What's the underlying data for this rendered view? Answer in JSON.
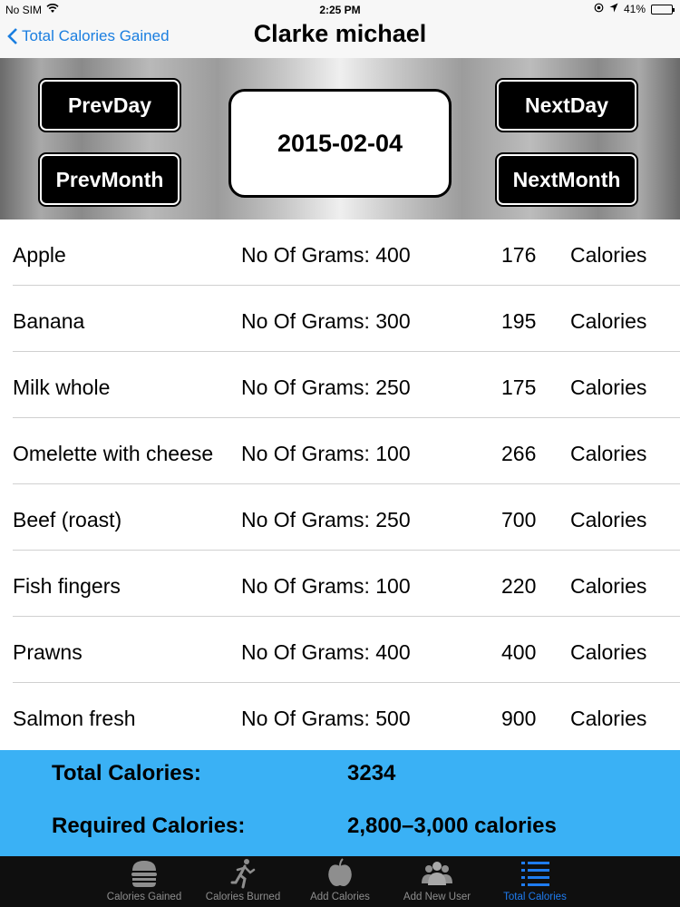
{
  "status_bar": {
    "carrier": "No SIM",
    "time": "2:25 PM",
    "battery": "41%",
    "battery_level": 0.41
  },
  "nav": {
    "back_label": "Total Calories Gained",
    "title": "Clarke michael"
  },
  "controls": {
    "prev_day": "PrevDay",
    "prev_month": "PrevMonth",
    "next_day": "NextDay",
    "next_month": "NextMonth",
    "date": "2015-02-04"
  },
  "foods": [
    {
      "name": "Apple",
      "grams": "No Of Grams: 400",
      "calories": "176",
      "unit": "Calories"
    },
    {
      "name": "Banana",
      "grams": "No Of Grams: 300",
      "calories": "195",
      "unit": "Calories"
    },
    {
      "name": "Milk whole",
      "grams": "No Of Grams: 250",
      "calories": "175",
      "unit": "Calories"
    },
    {
      "name": "Omelette with cheese",
      "grams": "No Of Grams: 100",
      "calories": "266",
      "unit": "Calories"
    },
    {
      "name": "Beef (roast)",
      "grams": "No Of Grams: 250",
      "calories": "700",
      "unit": "Calories"
    },
    {
      "name": "Fish fingers",
      "grams": "No Of Grams: 100",
      "calories": "220",
      "unit": "Calories"
    },
    {
      "name": "Prawns",
      "grams": "No Of Grams: 400",
      "calories": "400",
      "unit": "Calories"
    },
    {
      "name": "Salmon fresh",
      "grams": "No Of Grams: 500",
      "calories": "900",
      "unit": "Calories"
    }
  ],
  "totals": {
    "total_label": "Total Calories:",
    "total_value": "3234",
    "required_label": "Required  Calories:",
    "required_value": "2,800–3,000 calories"
  },
  "tabs": [
    {
      "label": "Calories Gained",
      "icon": "burger-icon"
    },
    {
      "label": "Calories Burned",
      "icon": "runner-icon"
    },
    {
      "label": "Add Calories",
      "icon": "apple-icon"
    },
    {
      "label": "Add New User",
      "icon": "users-icon"
    },
    {
      "label": "Total Calories",
      "icon": "list-icon"
    }
  ],
  "active_tab": "Total Calories",
  "colors": {
    "accent": "#1a7ee0",
    "totals_bg": "#3ab1f5",
    "tab_active": "#1f7cf0",
    "tab_bar_bg": "#0f0f0f"
  }
}
